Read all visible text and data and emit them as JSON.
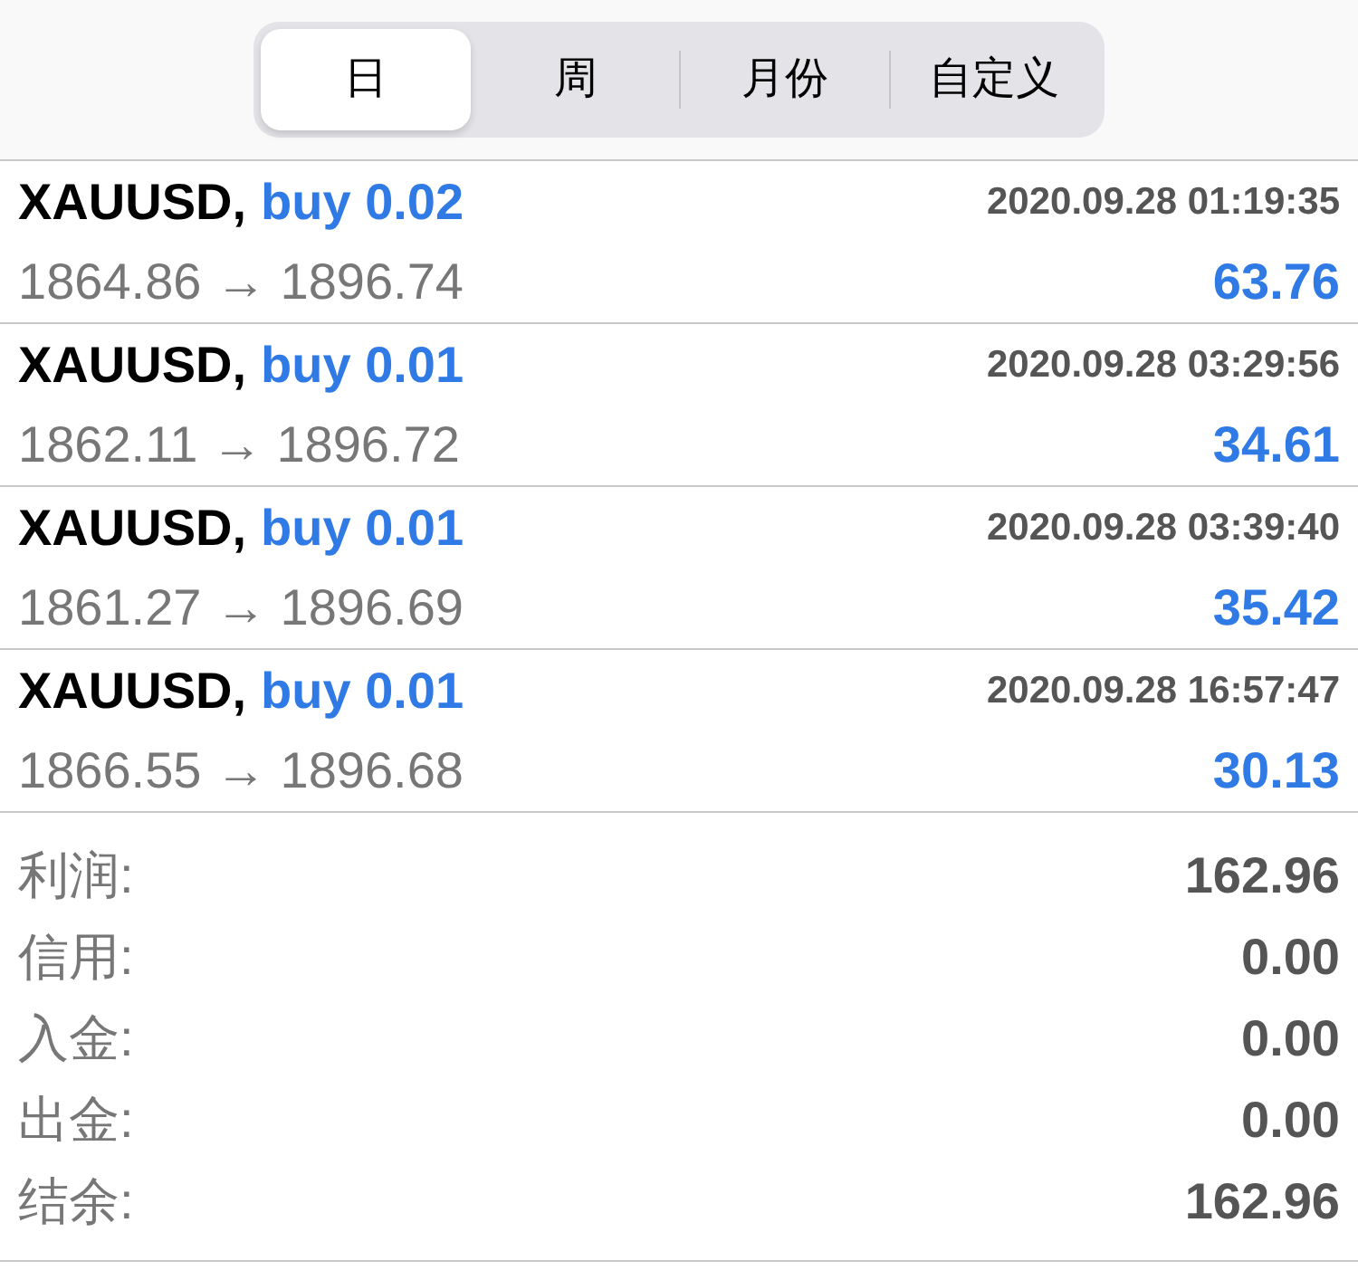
{
  "period_tabs": [
    {
      "label": "日",
      "selected": true
    },
    {
      "label": "周",
      "selected": false
    },
    {
      "label": "月份",
      "selected": false
    },
    {
      "label": "自定义",
      "selected": false
    }
  ],
  "trades": [
    {
      "symbol": "XAUUSD,",
      "side": "buy 0.02",
      "time": "2020.09.28 01:19:35",
      "prices": "1864.86 → 1896.74",
      "profit": "63.76"
    },
    {
      "symbol": "XAUUSD,",
      "side": "buy 0.01",
      "time": "2020.09.28 03:29:56",
      "prices": "1862.11 → 1896.72",
      "profit": "34.61"
    },
    {
      "symbol": "XAUUSD,",
      "side": "buy 0.01",
      "time": "2020.09.28 03:39:40",
      "prices": "1861.27 → 1896.69",
      "profit": "35.42"
    },
    {
      "symbol": "XAUUSD,",
      "side": "buy 0.01",
      "time": "2020.09.28 16:57:47",
      "prices": "1866.55 → 1896.68",
      "profit": "30.13"
    }
  ],
  "summary": [
    {
      "label": "利润:",
      "value": "162.96"
    },
    {
      "label": "信用:",
      "value": "0.00"
    },
    {
      "label": "入金:",
      "value": "0.00"
    },
    {
      "label": "出金:",
      "value": "0.00"
    },
    {
      "label": "结余:",
      "value": "162.96"
    }
  ]
}
